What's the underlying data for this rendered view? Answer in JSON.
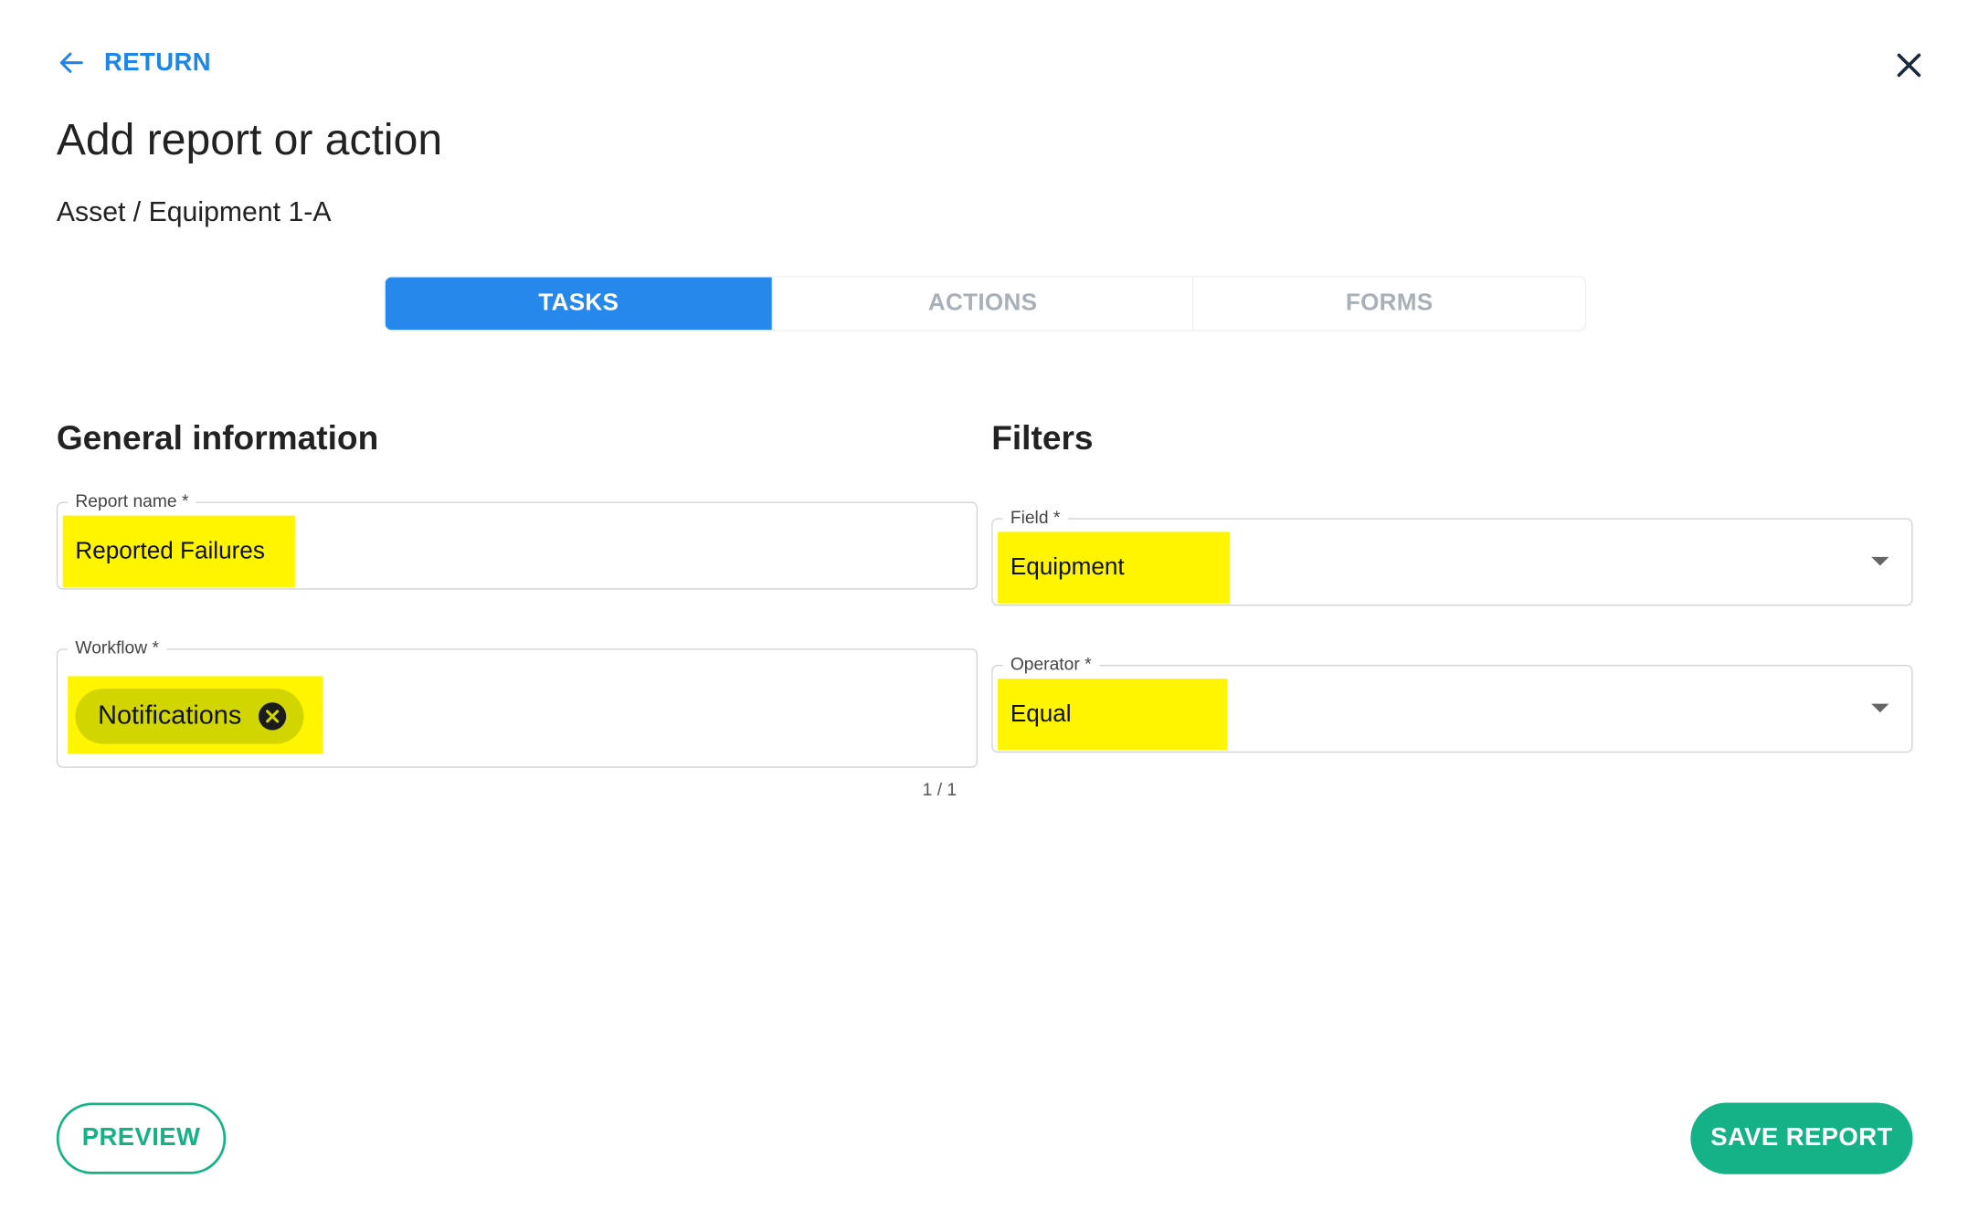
{
  "header": {
    "return_label": "RETURN",
    "return_icon": "arrow-left-icon",
    "close_icon": "close-icon",
    "title": "Add report or action",
    "breadcrumb": "Asset / Equipment 1-A"
  },
  "tabs": [
    {
      "label": "TASKS",
      "active": true
    },
    {
      "label": "ACTIONS",
      "active": false
    },
    {
      "label": "FORMS",
      "active": false
    }
  ],
  "general": {
    "heading": "General information",
    "report_name": {
      "label": "Report name *",
      "value": "Reported Failures"
    },
    "workflow": {
      "label": "Workflow *",
      "chip": "Notifications",
      "counter": "1 / 1"
    }
  },
  "filters": {
    "heading": "Filters",
    "field": {
      "label": "Field *",
      "value": "Equipment"
    },
    "operator": {
      "label": "Operator *",
      "value": "Equal"
    }
  },
  "footer": {
    "preview_label": "PREVIEW",
    "save_label": "SAVE REPORT"
  },
  "colors": {
    "primary_blue": "#2688eb",
    "accent_green": "#16b287",
    "highlight_yellow": "#fff500"
  }
}
